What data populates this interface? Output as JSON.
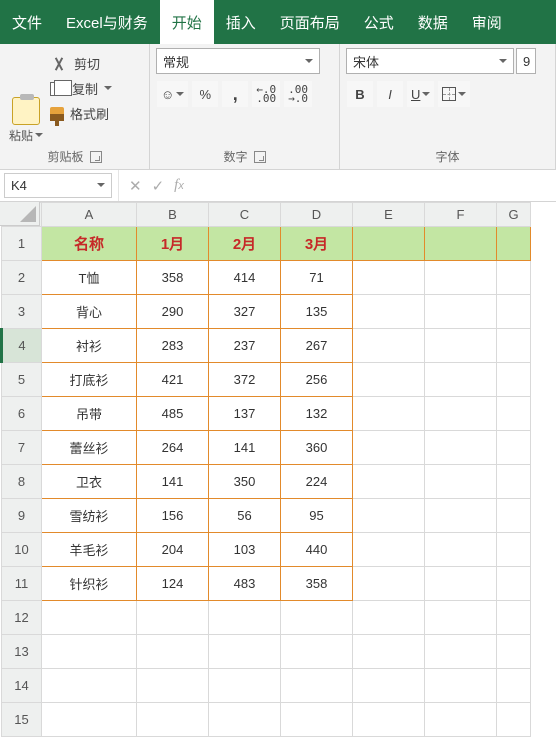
{
  "menu": {
    "file": "文件",
    "addin": "Excel与财务",
    "home": "开始",
    "insert": "插入",
    "layout": "页面布局",
    "formula": "公式",
    "data": "数据",
    "review": "审阅"
  },
  "ribbon": {
    "clipboard": {
      "paste": "粘贴",
      "cut": "剪切",
      "copy": "复制",
      "format_painter": "格式刷",
      "label": "剪贴板"
    },
    "number": {
      "format": "常规",
      "label": "数字"
    },
    "font": {
      "name": "宋体",
      "size": "9",
      "label": "字体",
      "bold": "B",
      "italic": "I",
      "underline": "U"
    }
  },
  "namebox": "K4",
  "columns": [
    "A",
    "B",
    "C",
    "D",
    "E",
    "F",
    "G"
  ],
  "row_numbers": [
    "1",
    "2",
    "3",
    "4",
    "5",
    "6",
    "7",
    "8",
    "9",
    "10",
    "11",
    "12",
    "13",
    "14",
    "15"
  ],
  "table": {
    "headers": [
      "名称",
      "1月",
      "2月",
      "3月"
    ],
    "rows": [
      [
        "T恤",
        "358",
        "414",
        "71"
      ],
      [
        "背心",
        "290",
        "327",
        "135"
      ],
      [
        "衬衫",
        "283",
        "237",
        "267"
      ],
      [
        "打底衫",
        "421",
        "372",
        "256"
      ],
      [
        "吊带",
        "485",
        "137",
        "132"
      ],
      [
        "蕾丝衫",
        "264",
        "141",
        "360"
      ],
      [
        "卫衣",
        "141",
        "350",
        "224"
      ],
      [
        "雪纺衫",
        "156",
        "56",
        "95"
      ],
      [
        "羊毛衫",
        "204",
        "103",
        "440"
      ],
      [
        "针织衫",
        "124",
        "483",
        "358"
      ]
    ]
  },
  "chart_data": {
    "type": "table",
    "title": "",
    "columns": [
      "名称",
      "1月",
      "2月",
      "3月"
    ],
    "rows": [
      [
        "T恤",
        358,
        414,
        71
      ],
      [
        "背心",
        290,
        327,
        135
      ],
      [
        "衬衫",
        283,
        237,
        267
      ],
      [
        "打底衫",
        421,
        372,
        256
      ],
      [
        "吊带",
        485,
        137,
        132
      ],
      [
        "蕾丝衫",
        264,
        141,
        360
      ],
      [
        "卫衣",
        141,
        350,
        224
      ],
      [
        "雪纺衫",
        156,
        56,
        95
      ],
      [
        "羊毛衫",
        204,
        103,
        440
      ],
      [
        "针织衫",
        124,
        483,
        358
      ]
    ]
  }
}
